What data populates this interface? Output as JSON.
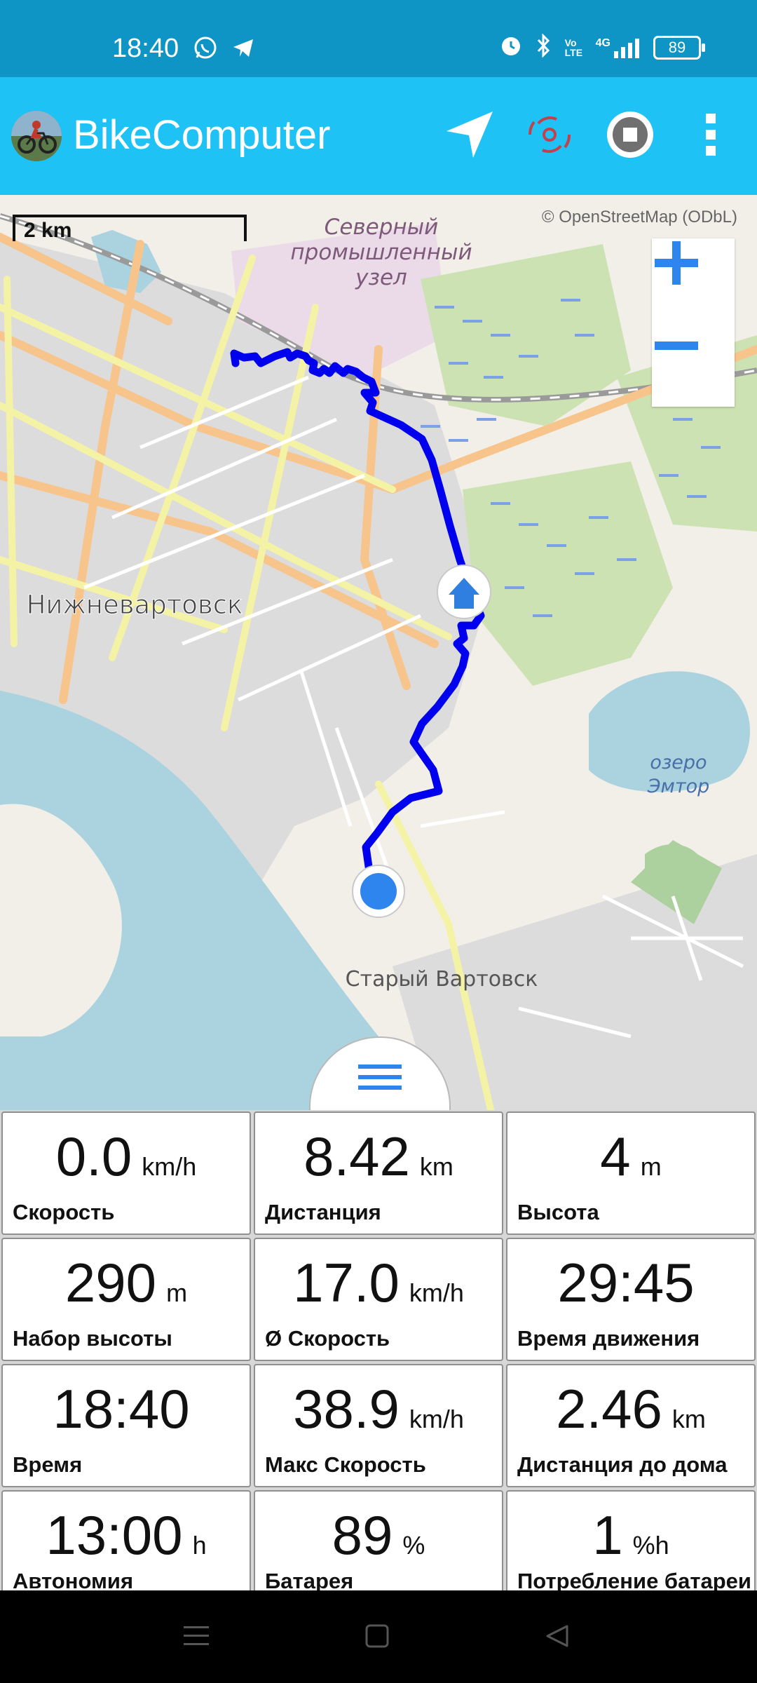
{
  "status_bar": {
    "time": "18:40",
    "battery": "89",
    "icons_left": [
      "whatsapp-icon",
      "telegram-icon"
    ],
    "icons_right": [
      "alarm-icon",
      "bluetooth-icon",
      "volte-icon",
      "signal-4g-icon",
      "battery-icon"
    ],
    "volte_label": "Vo LTE",
    "network_label": "4G"
  },
  "app_bar": {
    "title": "BikeComputer",
    "actions": [
      "navigation-arrow-icon",
      "gps-signal-icon",
      "stop-record-icon",
      "more-vert-icon"
    ],
    "background": "#1ec2f4"
  },
  "map": {
    "scale": "2 km",
    "attribution": "© OpenStreetMap (ODbL)",
    "labels": {
      "north_industrial_1": "Северный",
      "north_industrial_2": "промышленный",
      "north_industrial_3": "узел",
      "city": "Нижневартовск",
      "lake_1": "озеро",
      "lake_2": "Эмтор",
      "old_town": "Старый Вартовск"
    },
    "track_color": "#0000ee",
    "zoom_in": "+",
    "zoom_out": "−"
  },
  "metrics": [
    {
      "value": "0.0",
      "unit": "km/h",
      "label": "Скорость"
    },
    {
      "value": "8.42",
      "unit": "km",
      "label": "Дистанция"
    },
    {
      "value": "4",
      "unit": "m",
      "label": "Высота"
    },
    {
      "value": "290",
      "unit": "m",
      "label": "Набор высоты"
    },
    {
      "value": "17.0",
      "unit": "km/h",
      "label": "Ø Скорость"
    },
    {
      "value": "29:45",
      "unit": "",
      "label": "Время движения"
    },
    {
      "value": "18:40",
      "unit": "",
      "label": "Время"
    },
    {
      "value": "38.9",
      "unit": "km/h",
      "label": "Макс Скорость"
    },
    {
      "value": "2.46",
      "unit": "km",
      "label": "Дистанция до дома"
    },
    {
      "value": "13:00",
      "unit": "h",
      "label": "Автономия"
    },
    {
      "value": "89",
      "unit": "%",
      "label": "Батарея"
    },
    {
      "value": "1",
      "unit": "%h",
      "label": "Потребление батареи"
    }
  ]
}
